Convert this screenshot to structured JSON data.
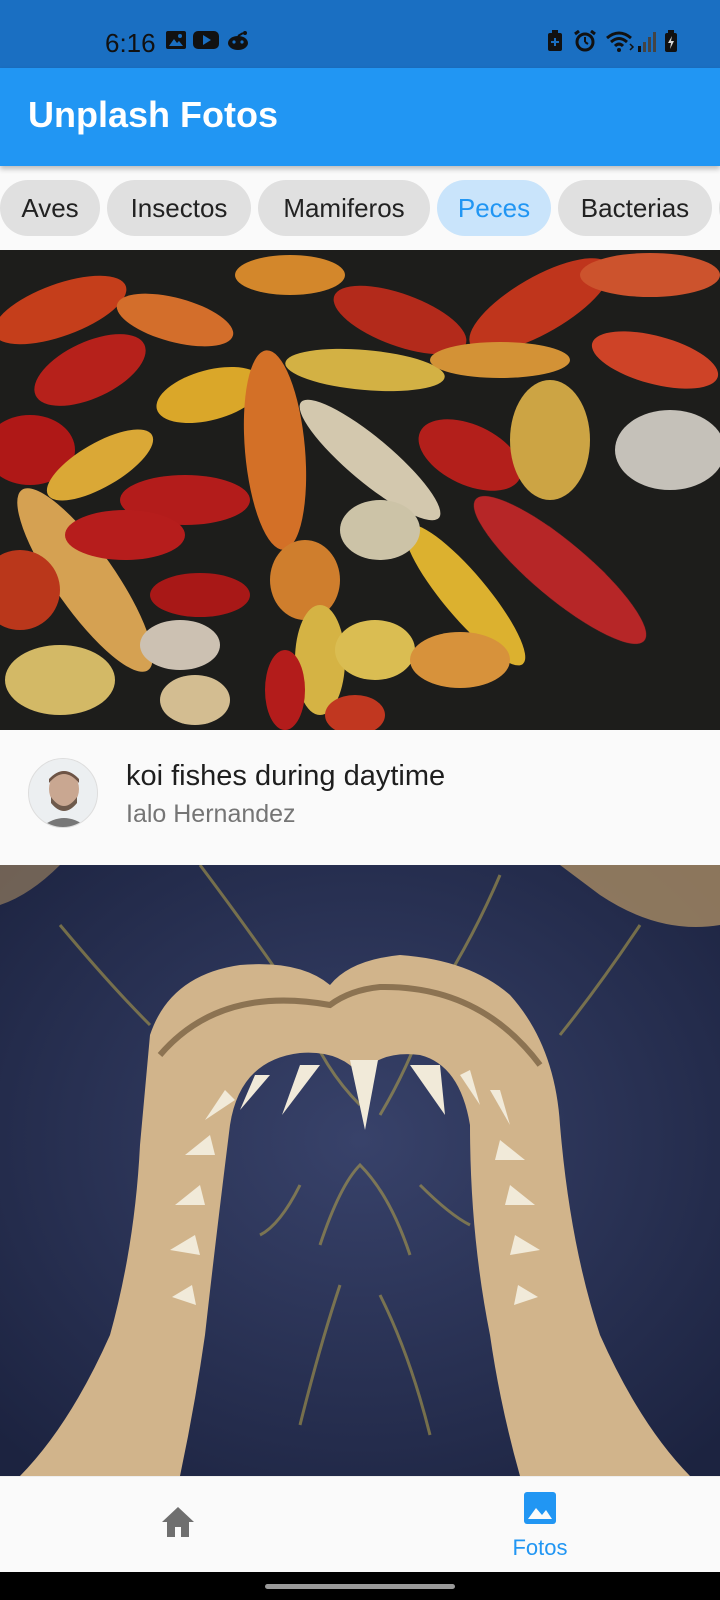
{
  "status_bar": {
    "time": "6:16",
    "left_icons": [
      "gallery-icon",
      "youtube-icon",
      "reddit-icon"
    ],
    "right_icons": [
      "battery-saver-icon",
      "alarm-icon",
      "wifi-icon",
      "signal-icon",
      "battery-icon"
    ]
  },
  "app_bar": {
    "title": "Unplash Fotos",
    "color": "#2196f3"
  },
  "categories": {
    "selected": "Peces",
    "items": [
      "Aves",
      "Insectos",
      "Mamiferos",
      "Peces",
      "Bacterias"
    ]
  },
  "photos": [
    {
      "title": "koi fishes during daytime",
      "author": "Ialo Hernandez"
    }
  ],
  "bottom_nav": {
    "items": [
      {
        "icon": "home-icon",
        "label": ""
      },
      {
        "icon": "photo-icon",
        "label": "Fotos",
        "active": true
      }
    ]
  }
}
